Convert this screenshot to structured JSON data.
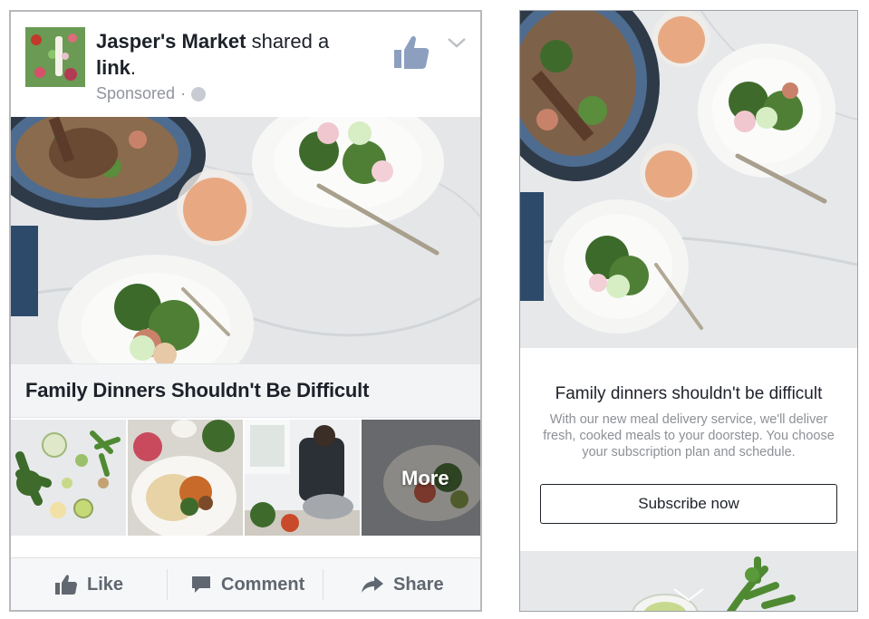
{
  "feed_ad": {
    "page_name": "Jasper's Market",
    "action_text": "shared a",
    "object_text": "link",
    "sponsored_label": "Sponsored",
    "separator": "·",
    "headline": "Family Dinners Shouldn't Be Difficult",
    "more_label": "More",
    "actions": {
      "like": "Like",
      "comment": "Comment",
      "share": "Share"
    }
  },
  "canvas": {
    "title": "Family dinners shouldn't be difficult",
    "body": "With our new meal delivery service, we'll deliver fresh, cooked meals to your doorstep. You choose your subscription plan and schedule.",
    "cta_label": "Subscribe now"
  },
  "colors": {
    "text": "#1d2129",
    "muted": "#90949c",
    "action_text": "#606770",
    "border": "#b7b9bd",
    "marble": "#e6e8ea",
    "plate_dark": "#2e3a48",
    "greens": "#3e6b2c"
  },
  "icons": [
    "page-logo-icon",
    "like-thumb-icon",
    "chevron-down-icon",
    "globe-icon",
    "comment-icon",
    "share-arrow-icon"
  ]
}
